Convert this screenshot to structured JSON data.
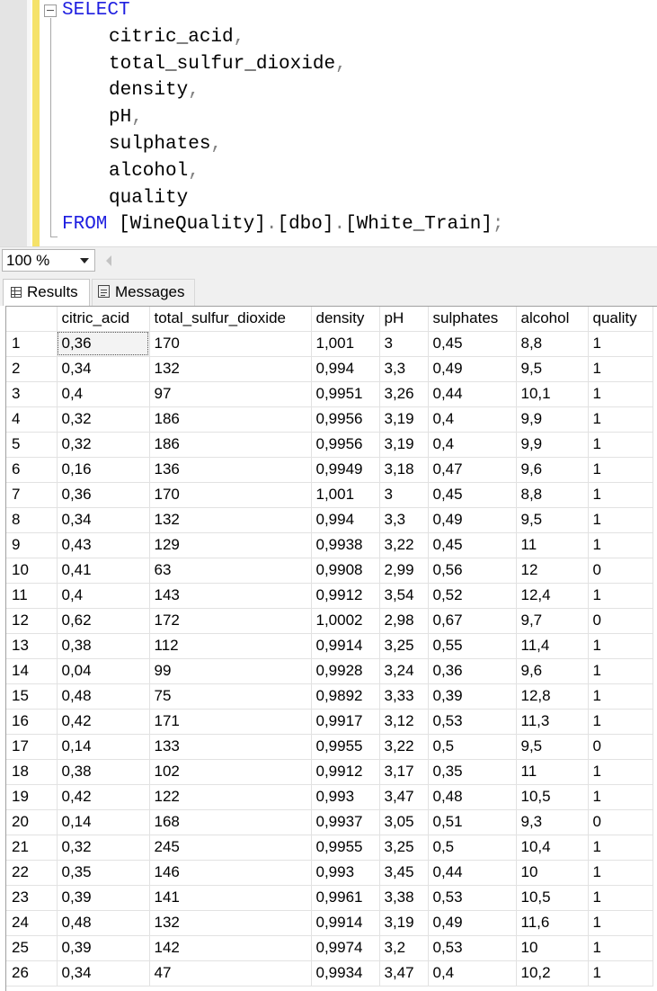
{
  "editor": {
    "lines": [
      {
        "kw": "SELECT",
        "id": "",
        "pn": ""
      },
      {
        "kw": "",
        "id": "citric_acid",
        "pn": ","
      },
      {
        "kw": "",
        "id": "total_sulfur_dioxide",
        "pn": ","
      },
      {
        "kw": "",
        "id": "density",
        "pn": ","
      },
      {
        "kw": "",
        "id": "pH",
        "pn": ","
      },
      {
        "kw": "",
        "id": "sulphates",
        "pn": ","
      },
      {
        "kw": "",
        "id": "alcohol",
        "pn": ","
      },
      {
        "kw": "",
        "id": "quality",
        "pn": ""
      }
    ],
    "from_line": {
      "kw": "FROM",
      "parts": [
        {
          "t": "id",
          "v": " [WineQuality]"
        },
        {
          "t": "pn",
          "v": "."
        },
        {
          "t": "id",
          "v": "[dbo]"
        },
        {
          "t": "pn",
          "v": "."
        },
        {
          "t": "id",
          "v": "[White_Train]"
        },
        {
          "t": "pn",
          "v": ";"
        }
      ]
    }
  },
  "zoom": {
    "value": "100 %"
  },
  "tabs": {
    "results": "Results",
    "messages": "Messages"
  },
  "grid": {
    "columns": [
      "citric_acid",
      "total_sulfur_dioxide",
      "density",
      "pH",
      "sulphates",
      "alcohol",
      "quality"
    ],
    "rows": [
      [
        "1",
        "0,36",
        "170",
        "1,001",
        "3",
        "0,45",
        "8,8",
        "1"
      ],
      [
        "2",
        "0,34",
        "132",
        "0,994",
        "3,3",
        "0,49",
        "9,5",
        "1"
      ],
      [
        "3",
        "0,4",
        "97",
        "0,9951",
        "3,26",
        "0,44",
        "10,1",
        "1"
      ],
      [
        "4",
        "0,32",
        "186",
        "0,9956",
        "3,19",
        "0,4",
        "9,9",
        "1"
      ],
      [
        "5",
        "0,32",
        "186",
        "0,9956",
        "3,19",
        "0,4",
        "9,9",
        "1"
      ],
      [
        "6",
        "0,16",
        "136",
        "0,9949",
        "3,18",
        "0,47",
        "9,6",
        "1"
      ],
      [
        "7",
        "0,36",
        "170",
        "1,001",
        "3",
        "0,45",
        "8,8",
        "1"
      ],
      [
        "8",
        "0,34",
        "132",
        "0,994",
        "3,3",
        "0,49",
        "9,5",
        "1"
      ],
      [
        "9",
        "0,43",
        "129",
        "0,9938",
        "3,22",
        "0,45",
        "11",
        "1"
      ],
      [
        "10",
        "0,41",
        "63",
        "0,9908",
        "2,99",
        "0,56",
        "12",
        "0"
      ],
      [
        "11",
        "0,4",
        "143",
        "0,9912",
        "3,54",
        "0,52",
        "12,4",
        "1"
      ],
      [
        "12",
        "0,62",
        "172",
        "1,0002",
        "2,98",
        "0,67",
        "9,7",
        "0"
      ],
      [
        "13",
        "0,38",
        "112",
        "0,9914",
        "3,25",
        "0,55",
        "11,4",
        "1"
      ],
      [
        "14",
        "0,04",
        "99",
        "0,9928",
        "3,24",
        "0,36",
        "9,6",
        "1"
      ],
      [
        "15",
        "0,48",
        "75",
        "0,9892",
        "3,33",
        "0,39",
        "12,8",
        "1"
      ],
      [
        "16",
        "0,42",
        "171",
        "0,9917",
        "3,12",
        "0,53",
        "11,3",
        "1"
      ],
      [
        "17",
        "0,14",
        "133",
        "0,9955",
        "3,22",
        "0,5",
        "9,5",
        "0"
      ],
      [
        "18",
        "0,38",
        "102",
        "0,9912",
        "3,17",
        "0,35",
        "11",
        "1"
      ],
      [
        "19",
        "0,42",
        "122",
        "0,993",
        "3,47",
        "0,48",
        "10,5",
        "1"
      ],
      [
        "20",
        "0,14",
        "168",
        "0,9937",
        "3,05",
        "0,51",
        "9,3",
        "0"
      ],
      [
        "21",
        "0,32",
        "245",
        "0,9955",
        "3,25",
        "0,5",
        "10,4",
        "1"
      ],
      [
        "22",
        "0,35",
        "146",
        "0,993",
        "3,45",
        "0,44",
        "10",
        "1"
      ],
      [
        "23",
        "0,39",
        "141",
        "0,9961",
        "3,38",
        "0,53",
        "10,5",
        "1"
      ],
      [
        "24",
        "0,48",
        "132",
        "0,9914",
        "3,19",
        "0,49",
        "11,6",
        "1"
      ],
      [
        "25",
        "0,39",
        "142",
        "0,9974",
        "3,2",
        "0,53",
        "10",
        "1"
      ],
      [
        "26",
        "0,34",
        "47",
        "0,9934",
        "3,47",
        "0,4",
        "10,2",
        "1"
      ]
    ]
  }
}
